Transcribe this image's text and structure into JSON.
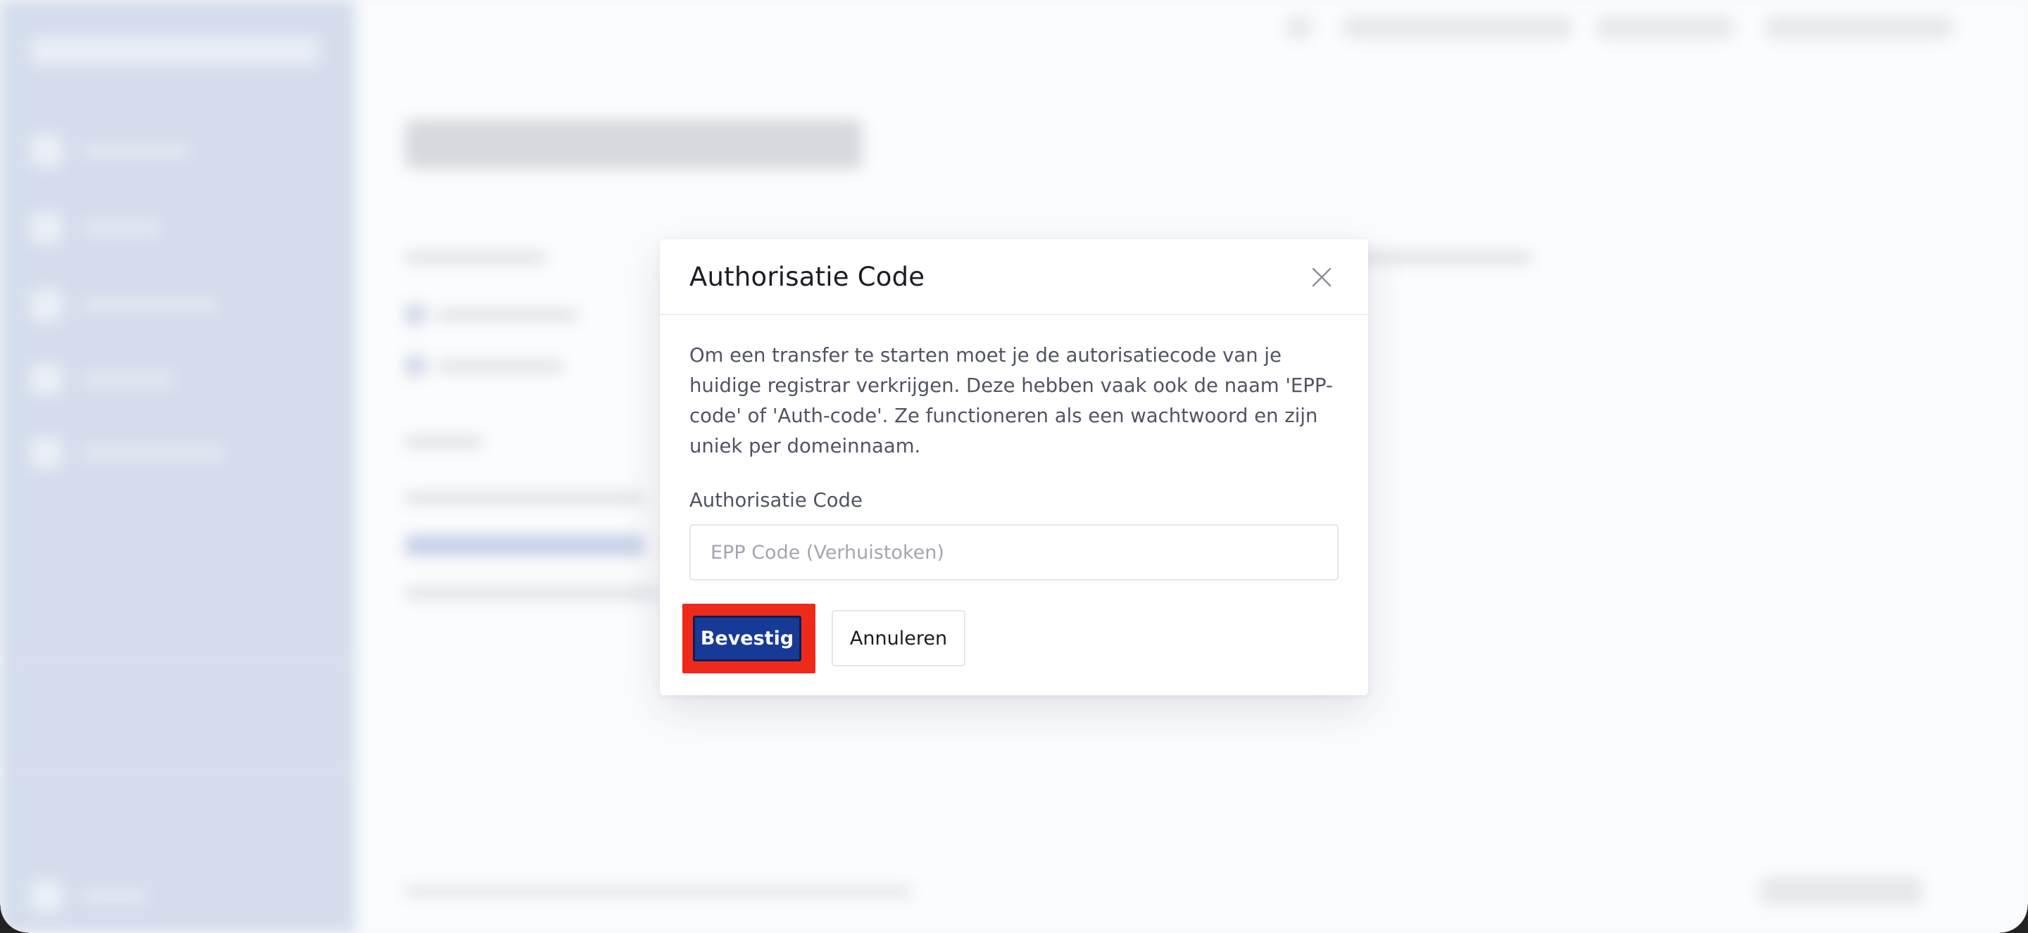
{
  "modal": {
    "title": "Authorisatie Code",
    "close_icon": "close-icon",
    "description": "Om een transfer te starten moet je de autorisatiecode van je huidige registrar verkrijgen. Deze hebben vaak ook de naam 'EPP-code' of 'Auth-code'. Ze functioneren als een wachtwoord en zijn uniek per domeinnaam.",
    "field_label": "Authorisatie Code",
    "field_value": "",
    "field_placeholder": "EPP Code (Verhuistoken)",
    "confirm_label": "Bevestig",
    "cancel_label": "Annuleren"
  },
  "colors": {
    "primary": "#173a96",
    "highlight": "#ee2a1b",
    "sidebar": "#ccd6ea"
  }
}
